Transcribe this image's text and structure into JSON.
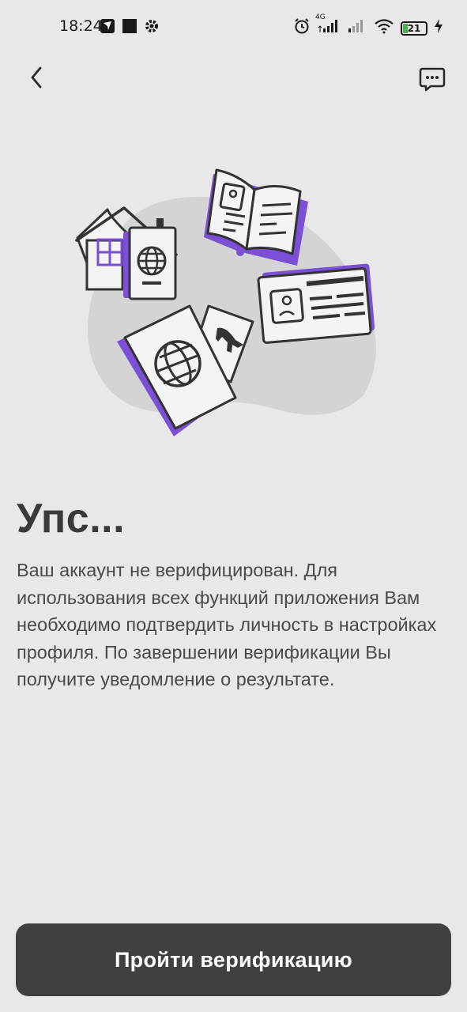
{
  "status_bar": {
    "time": "18:24",
    "battery_level": "21",
    "network_label": "4G",
    "icons": [
      "navigation-icon",
      "square-app-icon",
      "settings-icon",
      "alarm-icon",
      "signal-icon",
      "signal-icon",
      "wifi-icon",
      "battery-icon",
      "charging-icon"
    ]
  },
  "nav": {
    "back_icon": "chevron-left-icon",
    "chat_icon": "chat-bubble-icon"
  },
  "illustration": {
    "accent_color": "#7b4fd6",
    "items": [
      "house-icon",
      "passport-icon",
      "open-book-icon",
      "id-card-icon",
      "plane-ticket-icon"
    ]
  },
  "content": {
    "title": "Упс...",
    "description": "Ваш аккаунт не верифицирован. Для использования всех функций приложения Вам необходимо подтвердить личность в настройках профиля. По завершении верификации Вы получите уведомление о результате."
  },
  "actions": {
    "verify_button": "Пройти верификацию"
  },
  "colors": {
    "background": "#e8e8e8",
    "button": "#404040",
    "accent": "#7b4fd6"
  }
}
